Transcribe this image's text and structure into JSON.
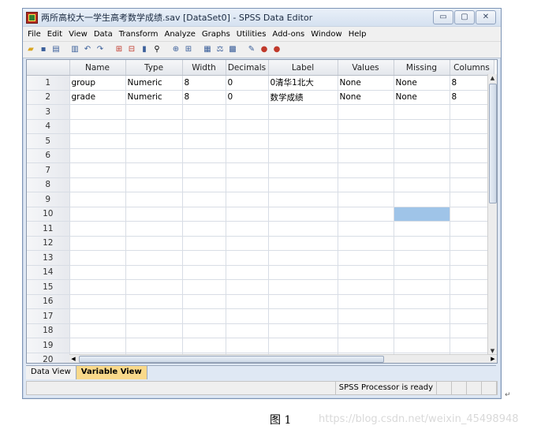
{
  "window": {
    "title": "两所高校大一学生高考数学成绩.sav [DataSet0] - SPSS Data Editor",
    "controls": [
      "▭",
      "▢",
      "✕"
    ]
  },
  "menu": [
    "File",
    "Edit",
    "View",
    "Data",
    "Transform",
    "Analyze",
    "Graphs",
    "Utilities",
    "Add-ons",
    "Window",
    "Help"
  ],
  "toolbar_icons": [
    "open-icon",
    "save-icon",
    "print-icon",
    "dialog-recall-icon",
    "undo-icon",
    "redo-icon",
    "goto-case-icon",
    "goto-variable-icon",
    "variables-icon",
    "find-icon",
    "insert-cases-icon",
    "insert-variable-icon",
    "split-file-icon",
    "weight-cases-icon",
    "select-cases-icon",
    "value-labels-icon",
    "use-sets-icon",
    "show-all-icon"
  ],
  "grid": {
    "columns": [
      "Name",
      "Type",
      "Width",
      "Decimals",
      "Label",
      "Values",
      "Missing",
      "Columns"
    ],
    "rows": [
      {
        "num": "1",
        "cells": [
          "group",
          "Numeric",
          "8",
          "0",
          "0清华1北大",
          "None",
          "None",
          "8"
        ]
      },
      {
        "num": "2",
        "cells": [
          "grade",
          "Numeric",
          "8",
          "0",
          "数学成绩",
          "None",
          "None",
          "8"
        ]
      },
      {
        "num": "3",
        "cells": [
          "",
          "",
          "",
          "",
          "",
          "",
          "",
          ""
        ]
      },
      {
        "num": "4",
        "cells": [
          "",
          "",
          "",
          "",
          "",
          "",
          "",
          ""
        ]
      },
      {
        "num": "5",
        "cells": [
          "",
          "",
          "",
          "",
          "",
          "",
          "",
          ""
        ]
      },
      {
        "num": "6",
        "cells": [
          "",
          "",
          "",
          "",
          "",
          "",
          "",
          ""
        ]
      },
      {
        "num": "7",
        "cells": [
          "",
          "",
          "",
          "",
          "",
          "",
          "",
          ""
        ]
      },
      {
        "num": "8",
        "cells": [
          "",
          "",
          "",
          "",
          "",
          "",
          "",
          ""
        ]
      },
      {
        "num": "9",
        "cells": [
          "",
          "",
          "",
          "",
          "",
          "",
          "",
          ""
        ]
      },
      {
        "num": "10",
        "cells": [
          "",
          "",
          "",
          "",
          "",
          "",
          "",
          ""
        ]
      },
      {
        "num": "11",
        "cells": [
          "",
          "",
          "",
          "",
          "",
          "",
          "",
          ""
        ]
      },
      {
        "num": "12",
        "cells": [
          "",
          "",
          "",
          "",
          "",
          "",
          "",
          ""
        ]
      },
      {
        "num": "13",
        "cells": [
          "",
          "",
          "",
          "",
          "",
          "",
          "",
          ""
        ]
      },
      {
        "num": "14",
        "cells": [
          "",
          "",
          "",
          "",
          "",
          "",
          "",
          ""
        ]
      },
      {
        "num": "15",
        "cells": [
          "",
          "",
          "",
          "",
          "",
          "",
          "",
          ""
        ]
      },
      {
        "num": "16",
        "cells": [
          "",
          "",
          "",
          "",
          "",
          "",
          "",
          ""
        ]
      },
      {
        "num": "17",
        "cells": [
          "",
          "",
          "",
          "",
          "",
          "",
          "",
          ""
        ]
      },
      {
        "num": "18",
        "cells": [
          "",
          "",
          "",
          "",
          "",
          "",
          "",
          ""
        ]
      },
      {
        "num": "19",
        "cells": [
          "",
          "",
          "",
          "",
          "",
          "",
          "",
          ""
        ]
      },
      {
        "num": "20",
        "cells": [
          "",
          "",
          "",
          "",
          "",
          "",
          "",
          ""
        ]
      }
    ],
    "selected_cell": {
      "row": 10,
      "column": "Missing"
    }
  },
  "tabs": [
    "Data View",
    "Variable View"
  ],
  "active_tab": "Variable View",
  "status": {
    "processor": "SPSS  Processor is ready"
  },
  "caption": "图 1",
  "watermark": "https://blog.csdn.net/weixin_45498948",
  "colors": {
    "selection": "#9fc4e8",
    "active_tab": "#f9d98a",
    "title_bar": "#dfe8f4"
  }
}
